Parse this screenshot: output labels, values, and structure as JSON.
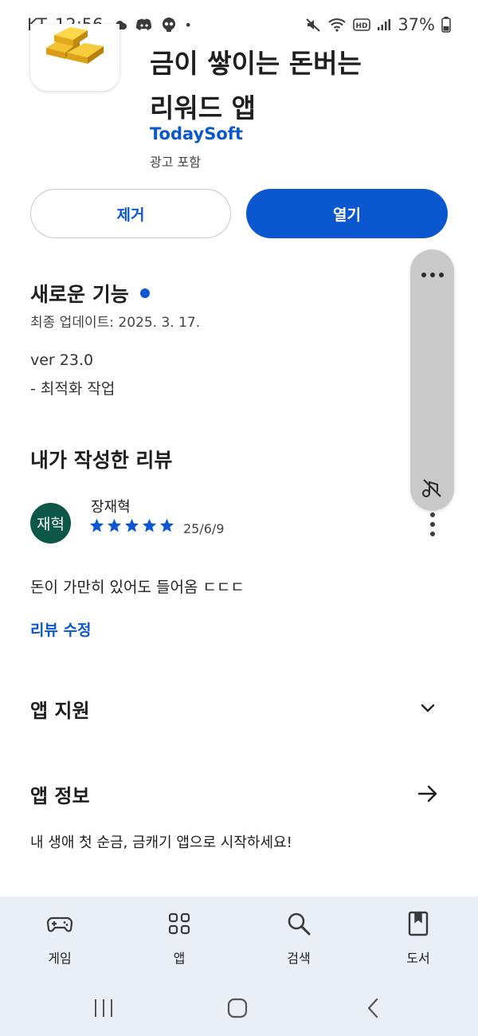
{
  "status_bar": {
    "carrier": "KT",
    "time": "12:56",
    "battery": "37%",
    "dot": "•"
  },
  "app": {
    "title_line1": "금이 쌓이는 돈버는",
    "title_line2": "리워드 앱",
    "developer": "TodaySoft",
    "ads_note": "광고 포함",
    "icon": "gold-bars-icon"
  },
  "buttons": {
    "remove": "제거",
    "open": "열기"
  },
  "whats_new": {
    "title": "새로운 기능",
    "last_updated": "최종 업데이트: 2025. 3. 17.",
    "version": "ver 23.0",
    "note": "- 최적화 작업"
  },
  "my_review": {
    "title": "내가 작성한 리뷰",
    "avatar_text": "재혁",
    "reviewer": "장재혁",
    "rating": 5,
    "date": "25/6/9",
    "text": "돈이 가만히 있어도 들어옴 ㄷㄷㄷ",
    "edit": "리뷰 수정"
  },
  "app_support": {
    "title": "앱 지원"
  },
  "app_info": {
    "title": "앱 정보",
    "description": "내 생애 첫 순금, 금캐기 앱으로 시작하세요!"
  },
  "bottom_nav": {
    "items": [
      {
        "label": "게임",
        "icon": "gamepad-icon"
      },
      {
        "label": "앱",
        "icon": "apps-grid-icon"
      },
      {
        "label": "검색",
        "icon": "search-icon"
      },
      {
        "label": "도서",
        "icon": "book-icon"
      }
    ]
  },
  "colors": {
    "accent": "#0b57d0",
    "avatar_bg": "#0d5748",
    "nav_bg": "#eaeef5"
  }
}
